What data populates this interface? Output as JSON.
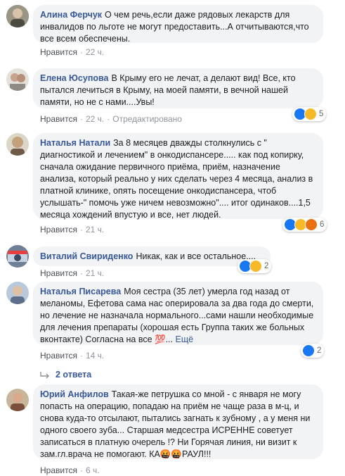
{
  "comments": [
    {
      "author": "Алина Ферчук",
      "text": "О чем речь,если даже рядовых лекарств для инвалидов по льготе не могут предоставить...А отчитываются,что все всем обеспечены.",
      "like": "Нравится",
      "time": "22 ч."
    },
    {
      "author": "Елена Юсупова",
      "text": "В Крыму его не лечат, а делают вид! Все, кто пытался лечиться в Крыму, на моей памяти, в вечной нашей памяти, но не с нами....Увы!",
      "like": "Нравится",
      "time": "22 ч.",
      "edited": "Отредактировано",
      "reactions_count": "5"
    },
    {
      "author": "Наталья Натали",
      "text": "За 8 месяцев дважды столкнулись с \" диагностикой и лечением\" в онкодиспансере..... как под копирку, сначала ожидание первичного приёма, приём, назначение анализа, который реально у них сделать через 4 месяца, анализ в платной клинике, опять посещение онкодиспансера, чтоб услышать-\" помочь уже ничем невозможно\".... итог одинаков....1,5 месяца хождений впустую и все, нет людей.",
      "like": "Нравится",
      "time": "21 ч.",
      "reactions_count": "6"
    },
    {
      "author": "Виталий Свириденко",
      "text": "Никак, как и все остальное....",
      "like": "Нравится",
      "time": "21 ч.",
      "reactions_count": "2"
    },
    {
      "author": "Наталья Писарева",
      "text": "Моя сестра (35 лет) умерла год назад от меланомы, Ефетова сама нас оперировала за два года до смерти, но лечение не назначала нормального...сами нашли необходимые для лечения препараты (хорошая есть Группа таких же больных вконтакте) Согласна на все 💯...",
      "more": "Ещё",
      "like": "Нравится",
      "time": "14 ч.",
      "reactions_count": "2"
    },
    {
      "author": "Юрий Анфилов",
      "text": "Такая-же петрушка со мной - с января не могу попасть на операцию, попадаю на приём не чаще раза в м-ц, и снова куда-то отсылают, пытались загнать к зубному , а у меня ни одного своего зуба... Старшая медсестра ИСРЕННЕ советует записаться в платную очерель !? Ни Горячая линия, ни визит к зам.гл.врача не помогают. КА🤬🤬РАУЛ!!!",
      "like": "Нравится",
      "time": "6 ч."
    }
  ],
  "replies_label": "2 ответа",
  "dot": "·"
}
